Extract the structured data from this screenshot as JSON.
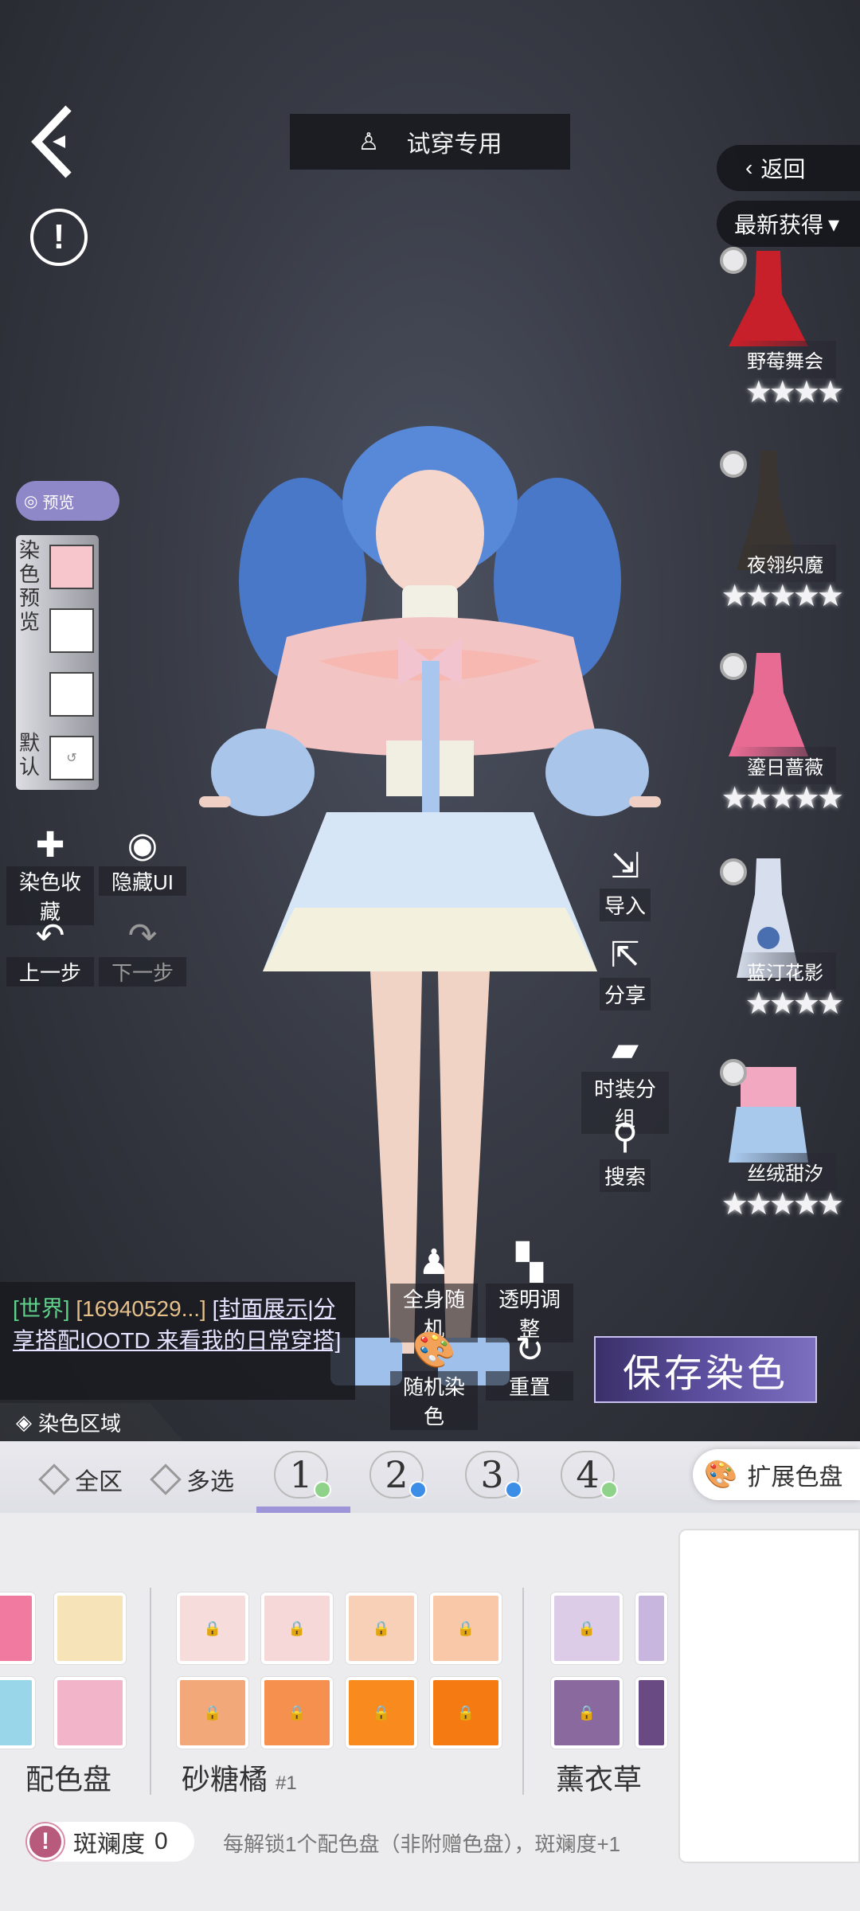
{
  "top": {
    "title": "试穿专用",
    "return_label": "返回",
    "sort_label": "最新获得"
  },
  "colors": {
    "accent": "#8e88c8",
    "tab_underline": "#9d95d8"
  },
  "wardrobe": [
    {
      "name": "野莓舞会",
      "stars": "★★★★"
    },
    {
      "name": "夜翎织魔",
      "stars": "★★★★★"
    },
    {
      "name": "鎏日蔷薇",
      "stars": "★★★★★"
    },
    {
      "name": "蓝汀花影",
      "stars": "★★★★"
    },
    {
      "name": "丝绒甜汐",
      "stars": "★★★★★"
    }
  ],
  "left_panel": {
    "preview_toggle": "预览",
    "dye_preview_label": "染色预览",
    "default_label": "默认",
    "tools": {
      "fav": "染色收藏",
      "hide_ui": "隐藏UI",
      "undo": "上一步",
      "redo": "下一步"
    }
  },
  "right_tools": {
    "import": "导入",
    "share": "分享",
    "group": "时装分组",
    "search": "搜索"
  },
  "bottom_tools": {
    "random_all": "全身随机",
    "transparency": "透明调整",
    "random_dye": "随机染色",
    "reset": "重置"
  },
  "save_label": "保存染色",
  "chat": {
    "channel": "[世界]",
    "user": "[16940529...]",
    "message": "[封面展示|分享搭配IOOTD 来看我的日常穿搭]"
  },
  "dye_area_label": "染色区域",
  "tabs": {
    "all": "全区",
    "multi": "多选",
    "numbers": [
      "1",
      "2",
      "3",
      "4"
    ],
    "expand": "扩展色盘"
  },
  "palettes": [
    {
      "name": "配色盘",
      "num": ""
    },
    {
      "name": "砂糖橘",
      "num": "#1"
    },
    {
      "name": "薰衣草",
      "num": ""
    }
  ],
  "spot": {
    "label": "斑斓度",
    "value": "0",
    "hint": "每解锁1个配色盘（非附赠色盘），斑斓度+1"
  }
}
